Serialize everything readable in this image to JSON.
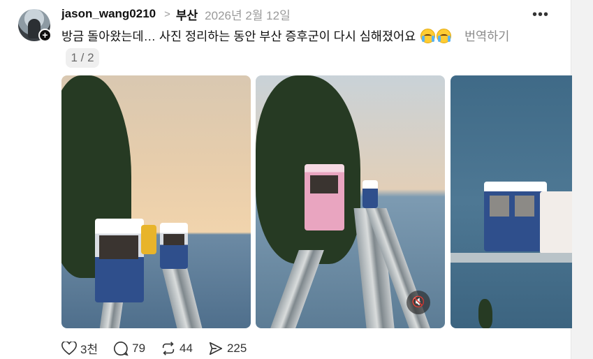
{
  "post": {
    "username": "jason_wang0210",
    "topic": "부산",
    "date": "2026년 2월 12일",
    "text": "방금 돌아왔는데… 사진 정리하는 동안 부산 증후군이 다시 심해졌어요",
    "translate_label": "번역하기",
    "media_counter": "1 / 2"
  },
  "actions": {
    "likes": "3천",
    "replies": "79",
    "reposts": "44",
    "shares": "225"
  },
  "icons": {
    "more": "more-options-icon",
    "plus": "follow-plus-icon",
    "mute": "mute-icon",
    "like": "heart-icon",
    "reply": "comment-icon",
    "repost": "repost-icon",
    "share": "send-icon"
  }
}
